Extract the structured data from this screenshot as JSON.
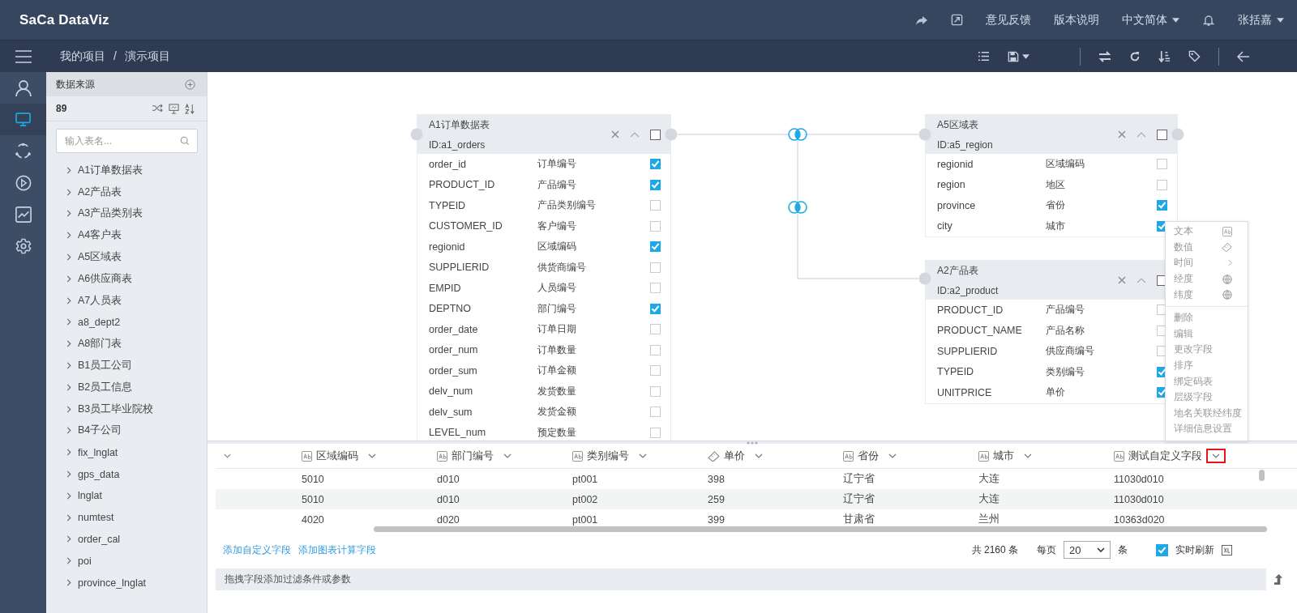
{
  "topbar": {
    "logo": "SaCa DataViz",
    "links": [
      "意见反馈",
      "版本说明"
    ],
    "language": "中文简体",
    "user": "张括嘉"
  },
  "breadcrumb": {
    "items": [
      "我的项目",
      "演示项目"
    ],
    "separator": "/"
  },
  "rail": [
    {
      "selected": false
    },
    {
      "selected": true
    },
    {
      "selected": false
    },
    {
      "selected": false
    },
    {
      "selected": false
    },
    {
      "selected": false
    }
  ],
  "sidebar": {
    "title": "数据来源",
    "count": "89",
    "search": {
      "placeholder": "输入表名..."
    },
    "items": [
      "A1订单数据表",
      "A2产品表",
      "A3产品类别表",
      "A4客户表",
      "A5区域表",
      "A6供应商表",
      "A7人员表",
      "a8_dept2",
      "A8部门表",
      "B1员工公司",
      "B2员工信息",
      "B3员工毕业院校",
      "B4子公司",
      "fix_lnglat",
      "gps_data",
      "lnglat",
      "numtest",
      "order_cal",
      "poi",
      "province_lnglat"
    ]
  },
  "tables": [
    {
      "title": "A1订单数据表",
      "id": "ID:a1_orders",
      "checked": false,
      "rows": [
        {
          "field": "order_id",
          "label": "订单编号",
          "checked": true
        },
        {
          "field": "PRODUCT_ID",
          "label": "产品编号",
          "checked": true
        },
        {
          "field": "TYPEID",
          "label": "产品类别编号",
          "checked": false
        },
        {
          "field": "CUSTOMER_ID",
          "label": "客户编号",
          "checked": false
        },
        {
          "field": "regionid",
          "label": "区域编码",
          "checked": true
        },
        {
          "field": "SUPPLIERID",
          "label": "供货商编号",
          "checked": false
        },
        {
          "field": "EMPID",
          "label": "人员编号",
          "checked": false
        },
        {
          "field": "DEPTNO",
          "label": "部门编号",
          "checked": true
        },
        {
          "field": "order_date",
          "label": "订单日期",
          "checked": false
        },
        {
          "field": "order_num",
          "label": "订单数量",
          "checked": false
        },
        {
          "field": "order_sum",
          "label": "订单金额",
          "checked": false
        },
        {
          "field": "delv_num",
          "label": "发货数量",
          "checked": false
        },
        {
          "field": "delv_sum",
          "label": "发货金额",
          "checked": false
        },
        {
          "field": "LEVEL_num",
          "label": "预定数量",
          "checked": false
        }
      ]
    },
    {
      "title": "A5区域表",
      "id": "ID:a5_region",
      "checked": false,
      "rows": [
        {
          "field": "regionid",
          "label": "区域编码",
          "checked": false
        },
        {
          "field": "region",
          "label": "地区",
          "checked": false
        },
        {
          "field": "province",
          "label": "省份",
          "checked": true
        },
        {
          "field": "city",
          "label": "城市",
          "checked": true
        }
      ]
    },
    {
      "title": "A2产品表",
      "id": "ID:a2_product",
      "checked": false,
      "rows": [
        {
          "field": "PRODUCT_ID",
          "label": "产品编号",
          "checked": false
        },
        {
          "field": "PRODUCT_NAME",
          "label": "产品名称",
          "checked": false
        },
        {
          "field": "SUPPLIERID",
          "label": "供应商编号",
          "checked": false
        },
        {
          "field": "TYPEID",
          "label": "类别编号",
          "checked": true
        },
        {
          "field": "UNITPRICE",
          "label": "单价",
          "checked": true
        }
      ]
    }
  ],
  "menu": [
    {
      "label": "文本",
      "kind": "text"
    },
    {
      "label": "数值",
      "kind": "number"
    },
    {
      "label": "时间",
      "kind": "time"
    },
    {
      "label": "经度",
      "kind": "geo"
    },
    {
      "label": "纬度",
      "kind": "geo"
    },
    {
      "label": "删除",
      "kind": "action"
    },
    {
      "label": "编辑",
      "kind": "action"
    },
    {
      "label": "更改字段",
      "kind": "action"
    },
    {
      "label": "排序",
      "kind": "action"
    },
    {
      "label": "绑定码表",
      "kind": "action"
    },
    {
      "label": "层级字段",
      "kind": "action"
    },
    {
      "label": "地名关联经纬度",
      "kind": "action"
    },
    {
      "label": "详细信息设置",
      "kind": "action"
    }
  ],
  "grid": {
    "columns": [
      {
        "label": "区域编码",
        "kind": "text",
        "highlighted": false
      },
      {
        "label": "部门编号",
        "kind": "text",
        "highlighted": false
      },
      {
        "label": "类别编号",
        "kind": "text",
        "highlighted": false
      },
      {
        "label": "单价",
        "kind": "number",
        "highlighted": false
      },
      {
        "label": "省份",
        "kind": "text",
        "highlighted": false
      },
      {
        "label": "城市",
        "kind": "text",
        "highlighted": false
      },
      {
        "label": "测试自定义字段",
        "kind": "text",
        "highlighted": true
      }
    ],
    "rows": [
      [
        "5010",
        "d010",
        "pt001",
        "398",
        "辽宁省",
        "大连",
        "11030d010"
      ],
      [
        "5010",
        "d010",
        "pt002",
        "259",
        "辽宁省",
        "大连",
        "11030d010"
      ],
      [
        "4020",
        "d020",
        "pt001",
        "399",
        "甘肃省",
        "兰州",
        "10363d020"
      ]
    ]
  },
  "footer": {
    "links": [
      "添加自定义字段",
      "添加图表计算字段"
    ],
    "total": "共 2160 条",
    "per_page": "每页",
    "page_size": "20",
    "unit": "条",
    "realtime": {
      "label": "实时刷新",
      "checked": true
    }
  },
  "filter": {
    "placeholder": "拖拽字段添加过滤条件或参数"
  }
}
